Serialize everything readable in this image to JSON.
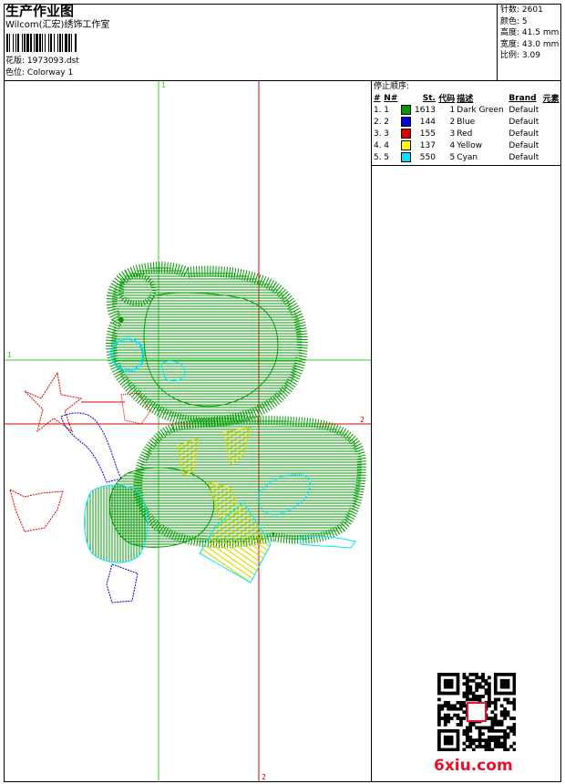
{
  "header": {
    "title": "生产作业图",
    "subtitle": "Wilcom(汇宏)绣饰工作室",
    "design_label": "花版:",
    "design_value": "1973093.dst",
    "colorway_label": "色位:",
    "colorway_value": "Colorway 1"
  },
  "stats": [
    {
      "label": "针数",
      "value": "2601"
    },
    {
      "label": "颜色",
      "value": "5"
    },
    {
      "label": "高度",
      "value": "41.5 mm"
    },
    {
      "label": "宽度",
      "value": "43.0 mm"
    },
    {
      "label": "比例",
      "value": "3.09"
    }
  ],
  "legend": {
    "title": "停止顺序:",
    "columns": {
      "hash": "#",
      "no": "N#",
      "st": "St.",
      "code": "代码",
      "desc": "描述",
      "brand": "Brand",
      "elem": "元素"
    },
    "rows": [
      {
        "hash": "1.",
        "no": "1",
        "color": "#009900",
        "st": "1613",
        "code": "1",
        "desc": "Dark Green",
        "brand": "Default"
      },
      {
        "hash": "2.",
        "no": "2",
        "color": "#0000dd",
        "st": "144",
        "code": "2",
        "desc": "Blue",
        "brand": "Default"
      },
      {
        "hash": "3.",
        "no": "3",
        "color": "#dd0000",
        "st": "155",
        "code": "3",
        "desc": "Red",
        "brand": "Default"
      },
      {
        "hash": "4.",
        "no": "4",
        "color": "#ffff00",
        "st": "137",
        "code": "4",
        "desc": "Yellow",
        "brand": "Default"
      },
      {
        "hash": "5.",
        "no": "5",
        "color": "#00e5ff",
        "st": "550",
        "code": "5",
        "desc": "Cyan",
        "brand": "Default"
      }
    ]
  },
  "axes": {
    "green_label": "1",
    "red_label": "2"
  },
  "colors": {
    "dark_green": "#009900",
    "blue": "#0000dd",
    "red": "#dd0000",
    "yellow": "#ffff00",
    "cyan": "#00e5ff",
    "axis_green": "#33cc33",
    "axis_red": "#dd0000"
  },
  "watermark": {
    "site": "6xiu.com"
  }
}
